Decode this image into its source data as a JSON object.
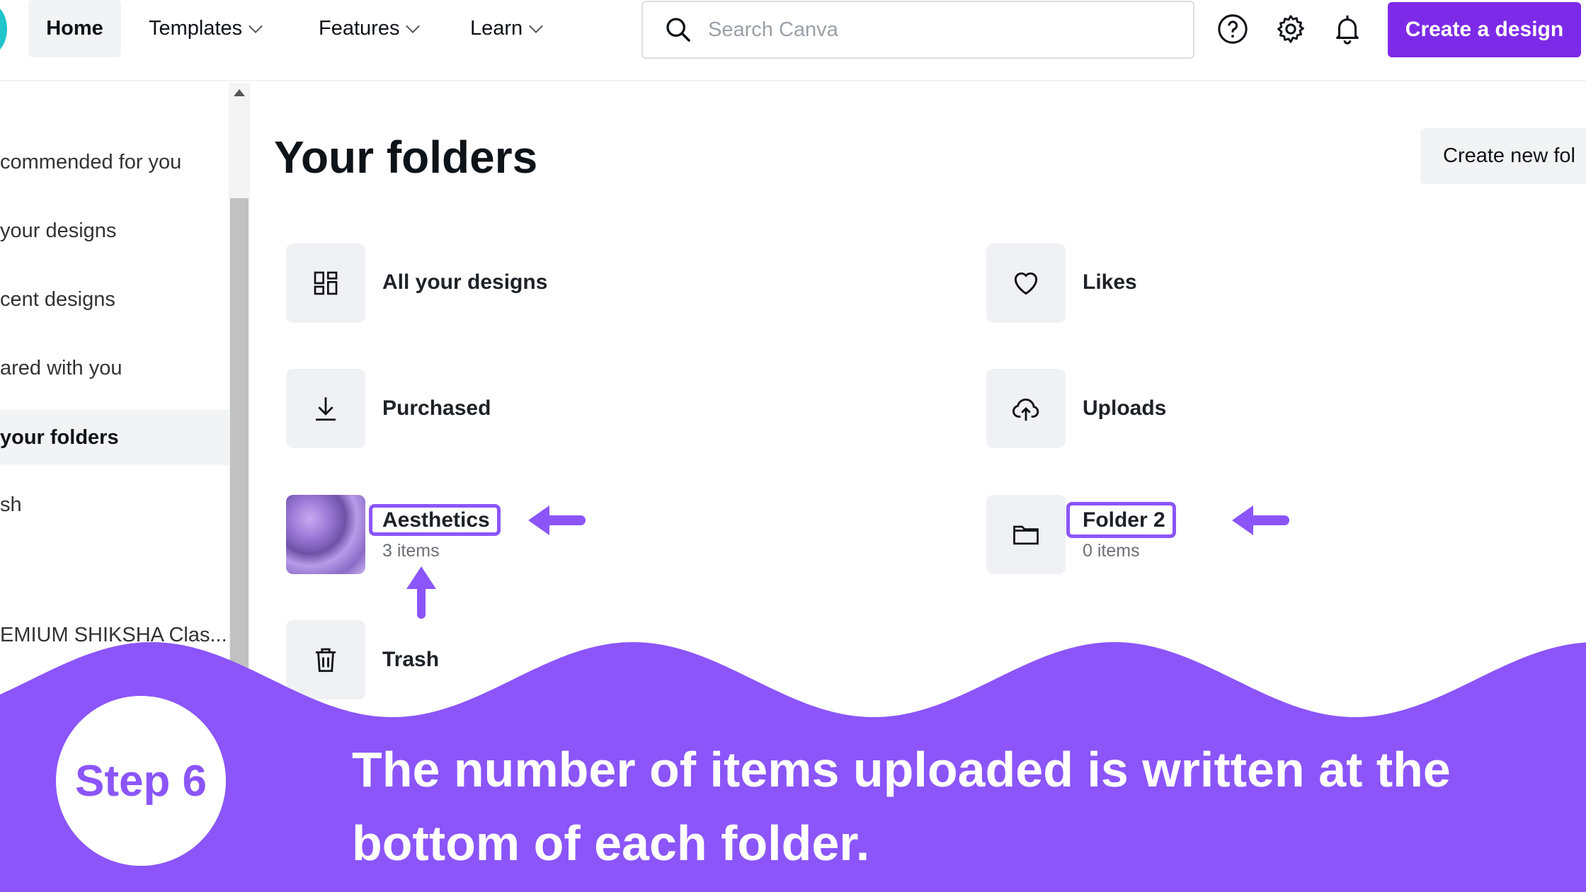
{
  "nav": {
    "home": "Home",
    "templates": "Templates",
    "features": "Features",
    "learn": "Learn",
    "search_placeholder": "Search Canva",
    "create_button": "Create a design"
  },
  "sidebar": {
    "items": [
      {
        "label": "commended for you"
      },
      {
        "label": "your designs"
      },
      {
        "label": "cent designs"
      },
      {
        "label": "ared with you"
      },
      {
        "label": " your folders"
      },
      {
        "label": "sh"
      },
      {
        "label": "EMIUM SHIKSHA Clas..."
      }
    ]
  },
  "main": {
    "title": "Your folders",
    "create_folder": "Create new fol",
    "folders": [
      {
        "label": "All your designs",
        "icon": "grid-icon"
      },
      {
        "label": "Likes",
        "icon": "heart-icon"
      },
      {
        "label": "Purchased",
        "icon": "download-icon"
      },
      {
        "label": "Uploads",
        "icon": "cloud-upload-icon"
      },
      {
        "label": "Aesthetics",
        "sub": "3 items"
      },
      {
        "label": "Folder 2",
        "sub": "0 items",
        "icon": "folder-icon"
      },
      {
        "label": "Trash",
        "icon": "trash-icon"
      }
    ]
  },
  "overlay": {
    "step": "Step 6",
    "caption": "The number of items uploaded is written at the bottom of each folder.",
    "color": "#8b55f9"
  },
  "colors": {
    "accent": "#7d2ae8",
    "overlay": "#8b55f9"
  }
}
